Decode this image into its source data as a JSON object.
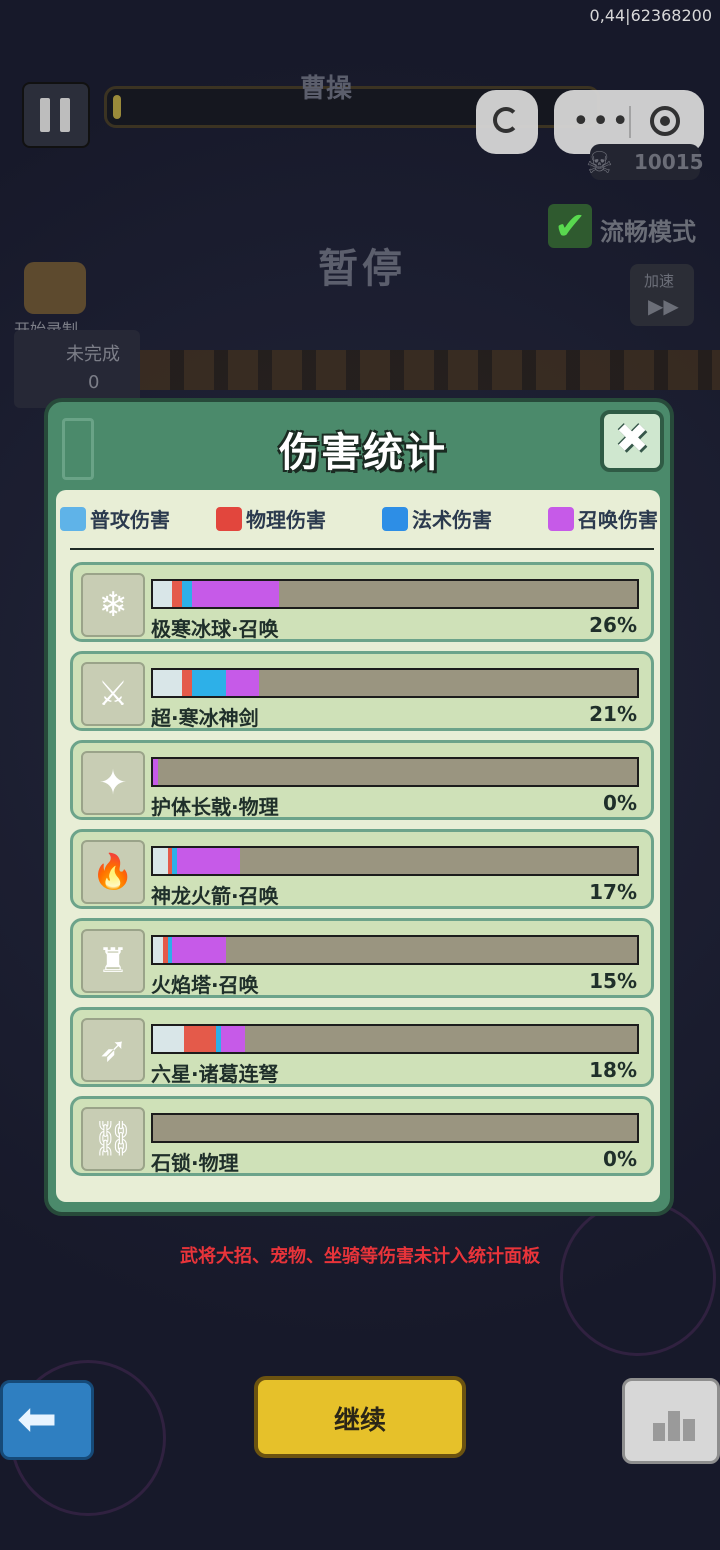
{
  "debug_id": "0,44|62368200",
  "hud": {
    "boss_name": "曹操",
    "kills": "10015",
    "smooth_mode": "流畅模式",
    "paused_title": "暂停",
    "record_label": "开始录制",
    "speed_label": "加速",
    "speed_arrow": "▶▶",
    "quest_status": "未完成",
    "quest_count": "0"
  },
  "panel": {
    "title": "伤害统计",
    "close_glyph": "✖",
    "legend": [
      {
        "label": "普攻伤害",
        "color": "#5fb3e8",
        "icon": "sword-icon"
      },
      {
        "label": "物理伤害",
        "color": "#e2463d",
        "icon": "claw-icon"
      },
      {
        "label": "法术伤害",
        "color": "#2d8ee6",
        "icon": "flame-icon"
      },
      {
        "label": "召唤伤害",
        "color": "#c65ae8",
        "icon": "paw-icon"
      }
    ],
    "rows": [
      {
        "name": "极寒冰球·召唤",
        "pct": "26%",
        "icon_glyph": "❄",
        "icon": "ice-orb-icon",
        "segments": [
          {
            "color": "#d9e6e8",
            "w": 0.04
          },
          {
            "color": "#e45a4a",
            "w": 0.02
          },
          {
            "color": "#2db0e8",
            "w": 0.02
          },
          {
            "color": "#c65ae8",
            "w": 0.18
          }
        ]
      },
      {
        "name": "超·寒冰神剑",
        "pct": "21%",
        "icon_glyph": "⚔",
        "icon": "ice-sword-icon",
        "segments": [
          {
            "color": "#d9e6e8",
            "w": 0.06
          },
          {
            "color": "#e45a4a",
            "w": 0.02
          },
          {
            "color": "#2db0e8",
            "w": 0.07
          },
          {
            "color": "#c65ae8",
            "w": 0.07
          }
        ]
      },
      {
        "name": "护体长戟·物理",
        "pct": "0%",
        "icon_glyph": "✦",
        "icon": "halberd-icon",
        "segments": [
          {
            "color": "#c65ae8",
            "w": 0.01
          }
        ]
      },
      {
        "name": "神龙火箭·召唤",
        "pct": "17%",
        "icon_glyph": "🔥",
        "icon": "dragon-rocket-icon",
        "segments": [
          {
            "color": "#d9e6e8",
            "w": 0.03
          },
          {
            "color": "#e45a4a",
            "w": 0.01
          },
          {
            "color": "#2db0e8",
            "w": 0.01
          },
          {
            "color": "#c65ae8",
            "w": 0.13
          }
        ]
      },
      {
        "name": "火焰塔·召唤",
        "pct": "15%",
        "icon_glyph": "♜",
        "icon": "flame-tower-icon",
        "segments": [
          {
            "color": "#d9e6e8",
            "w": 0.02
          },
          {
            "color": "#e45a4a",
            "w": 0.01
          },
          {
            "color": "#2db0e8",
            "w": 0.01
          },
          {
            "color": "#c65ae8",
            "w": 0.11
          }
        ]
      },
      {
        "name": "六星·诸葛连弩",
        "pct": "18%",
        "icon_glyph": "➶",
        "icon": "crossbow-icon",
        "segments": [
          {
            "color": "#d9e6e8",
            "w": 0.065
          },
          {
            "color": "#e45a4a",
            "w": 0.065
          },
          {
            "color": "#2db0e8",
            "w": 0.01
          },
          {
            "color": "#c65ae8",
            "w": 0.05
          }
        ]
      },
      {
        "name": "石锁·物理",
        "pct": "0%",
        "icon_glyph": "⛓",
        "icon": "stone-lock-icon",
        "segments": []
      }
    ],
    "footnote": "武将大招、宠物、坐骑等伤害未计入统计面板"
  },
  "buttons": {
    "continue_label": "继续",
    "back_glyph": "⬅"
  }
}
